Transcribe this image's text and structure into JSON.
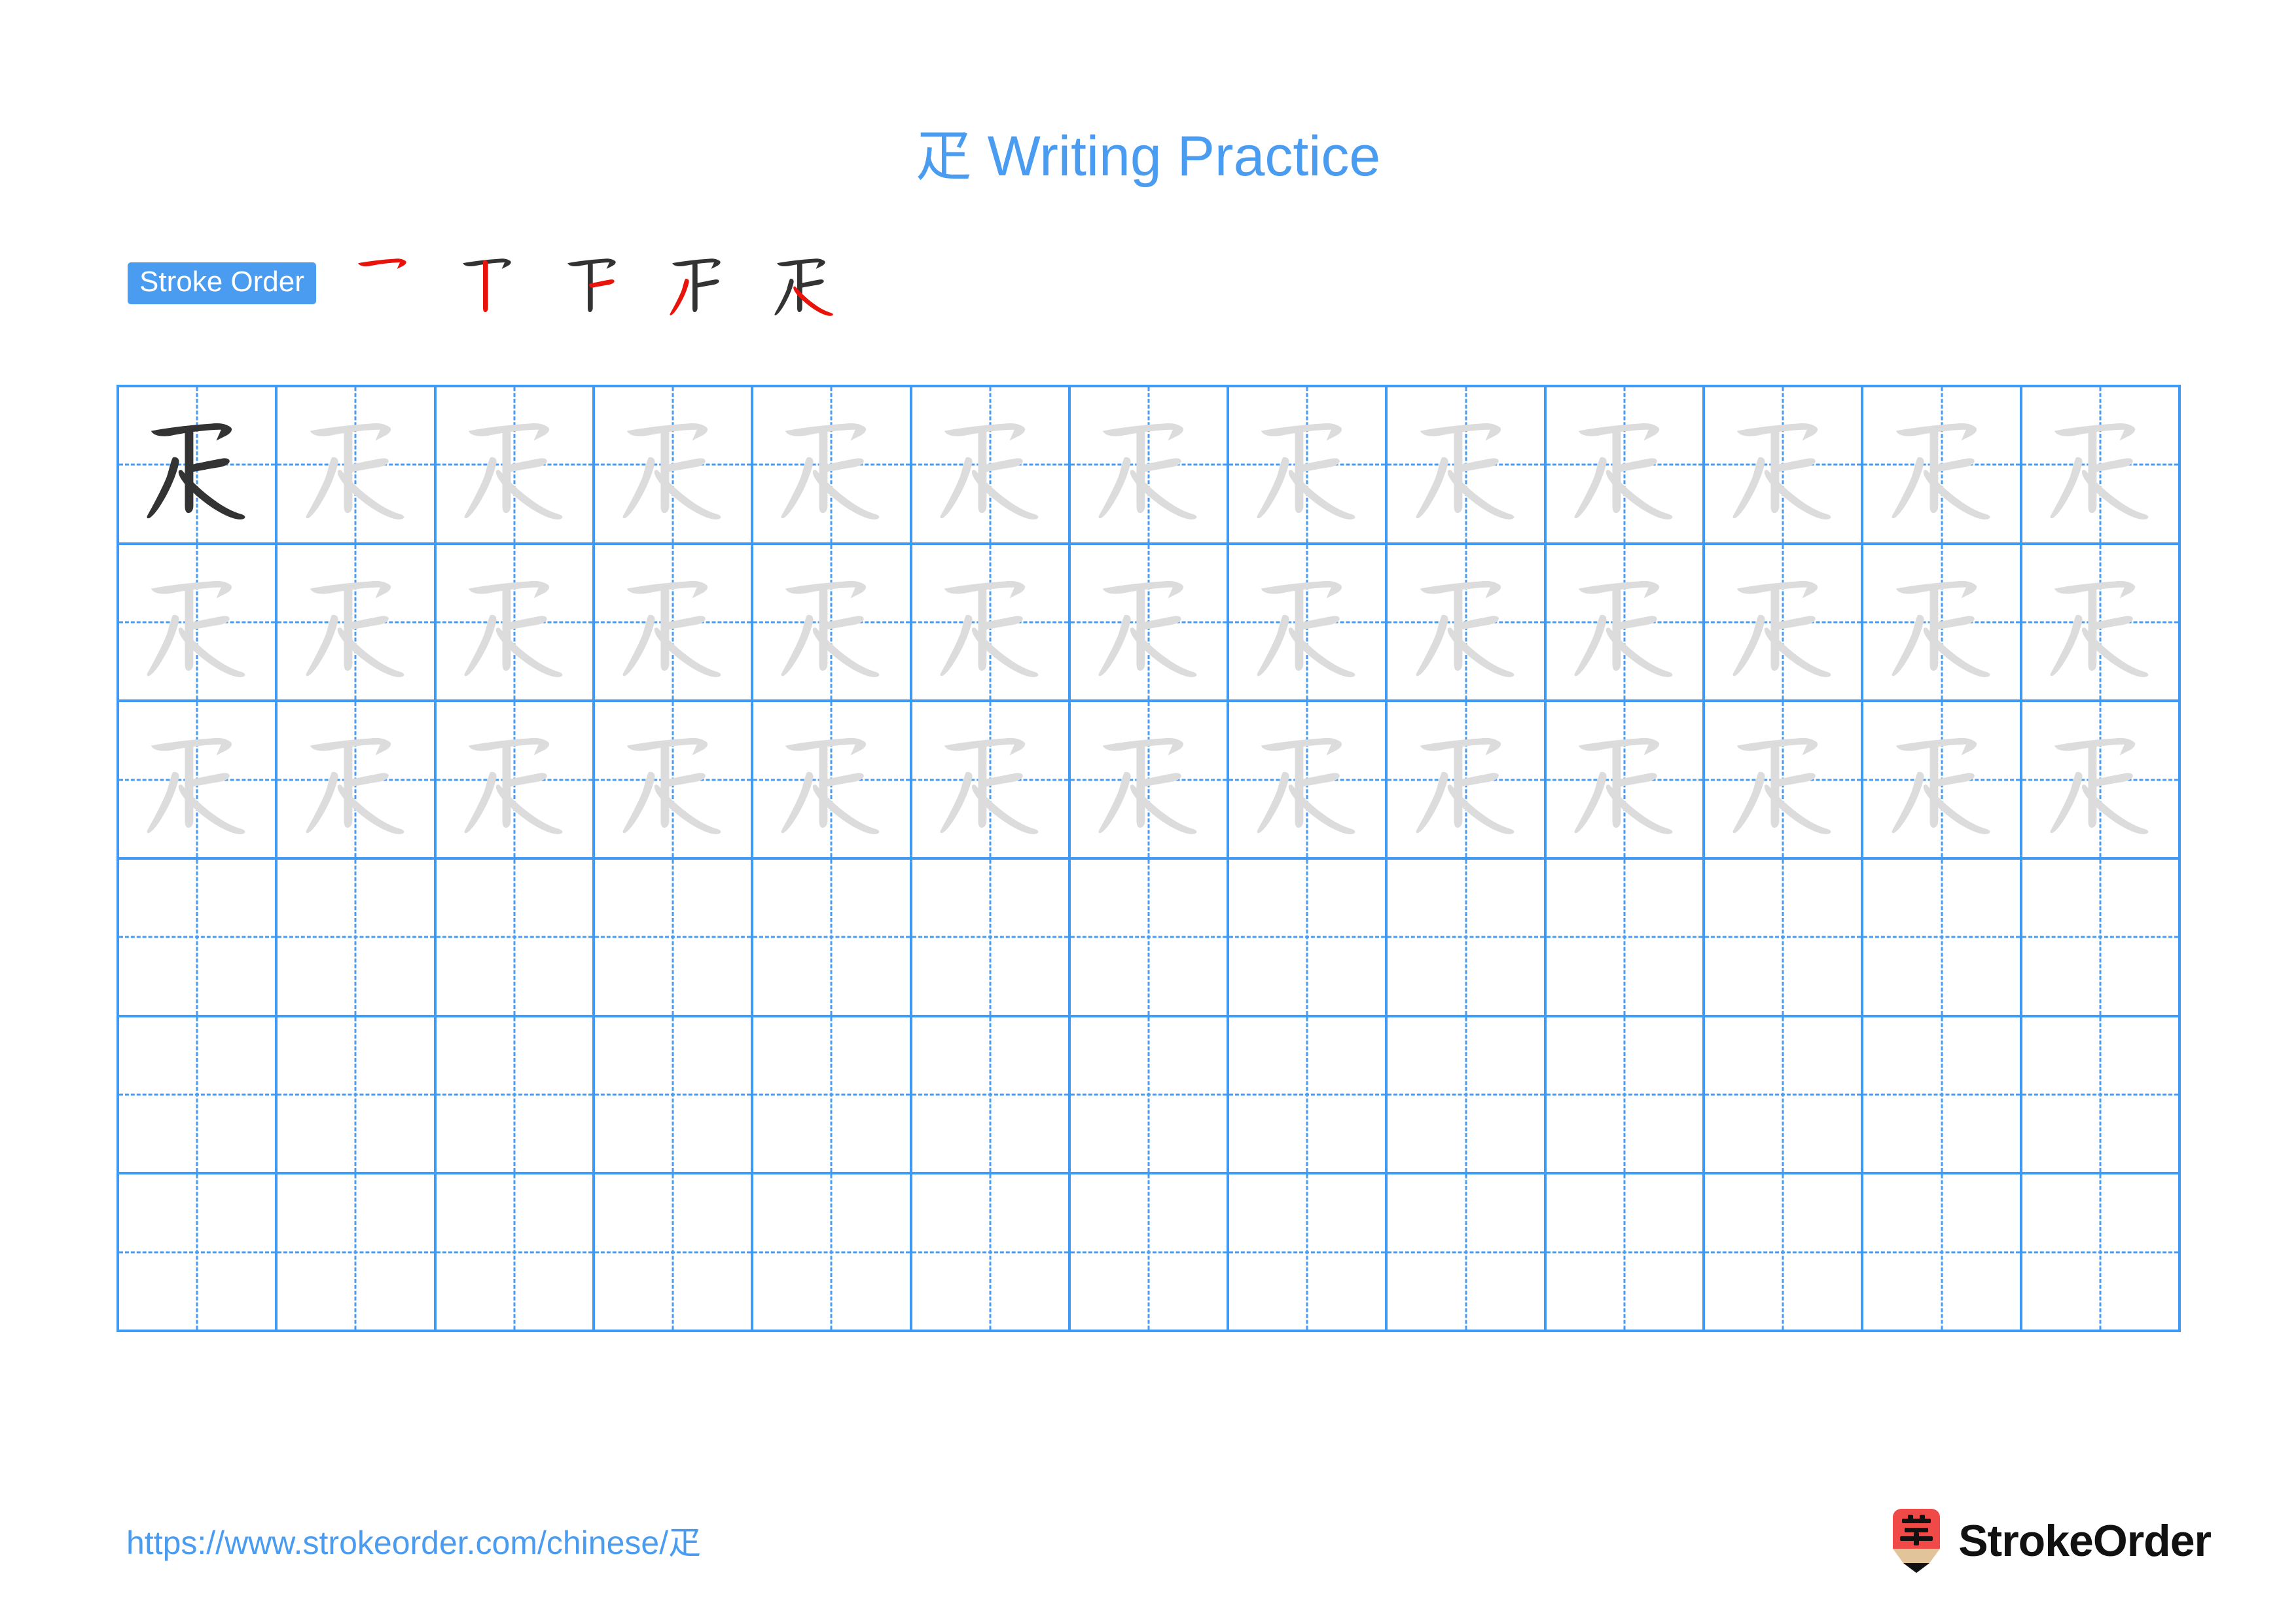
{
  "page": {
    "character": "疋",
    "title": "疋 Writing Practice",
    "accent_color": "#4a9cf0",
    "grid_line_color": "#3d9bf5",
    "trace_color": "#dcdcdc",
    "model_color": "#333333",
    "new_stroke_color": "#e8140c"
  },
  "stroke_order": {
    "badge_label": "Stroke Order",
    "stroke_count": 5,
    "steps": [
      {
        "index": 1,
        "name": "stroke-step-1",
        "strokes_shown": 1
      },
      {
        "index": 2,
        "name": "stroke-step-2",
        "strokes_shown": 2
      },
      {
        "index": 3,
        "name": "stroke-step-3",
        "strokes_shown": 3
      },
      {
        "index": 4,
        "name": "stroke-step-4",
        "strokes_shown": 4
      },
      {
        "index": 5,
        "name": "stroke-step-5",
        "strokes_shown": 5
      }
    ]
  },
  "grid": {
    "columns": 13,
    "rows": 6,
    "cells": [
      [
        "model",
        "trace",
        "trace",
        "trace",
        "trace",
        "trace",
        "trace",
        "trace",
        "trace",
        "trace",
        "trace",
        "trace",
        "trace"
      ],
      [
        "trace",
        "trace",
        "trace",
        "trace",
        "trace",
        "trace",
        "trace",
        "trace",
        "trace",
        "trace",
        "trace",
        "trace",
        "trace"
      ],
      [
        "trace",
        "trace",
        "trace",
        "trace",
        "trace",
        "trace",
        "trace",
        "trace",
        "trace",
        "trace",
        "trace",
        "trace",
        "trace"
      ],
      [
        "empty",
        "empty",
        "empty",
        "empty",
        "empty",
        "empty",
        "empty",
        "empty",
        "empty",
        "empty",
        "empty",
        "empty",
        "empty"
      ],
      [
        "empty",
        "empty",
        "empty",
        "empty",
        "empty",
        "empty",
        "empty",
        "empty",
        "empty",
        "empty",
        "empty",
        "empty",
        "empty"
      ],
      [
        "empty",
        "empty",
        "empty",
        "empty",
        "empty",
        "empty",
        "empty",
        "empty",
        "empty",
        "empty",
        "empty",
        "empty",
        "empty"
      ]
    ]
  },
  "footer": {
    "url": "https://www.strokeorder.com/chinese/疋",
    "brand_name": "StrokeOrder",
    "logo_character": "字",
    "logo_body_color": "#ef4a48",
    "logo_wood_color": "#e2c49a",
    "logo_tip_color": "#111111"
  }
}
